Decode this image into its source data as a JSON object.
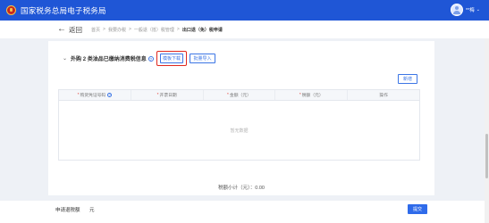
{
  "header": {
    "title": "国家税务总局电子税务局",
    "user_name": "**梅",
    "caret": "⌄"
  },
  "breadcrumb": {
    "back_arrow": "←",
    "back_label": "返回",
    "items": [
      "首页",
      "我要办税",
      "一般退（抵）税管理",
      "出口退（免）税申请"
    ],
    "separator": ">"
  },
  "section": {
    "chevron": "⌄",
    "title": "外购 2 类油品已缴纳消费税信息",
    "help": "?",
    "template_button": "模板下载",
    "import_button": "批量导入",
    "add_button": "新增"
  },
  "table": {
    "columns": [
      {
        "label": "购货凭证号码",
        "required": true,
        "help": true
      },
      {
        "label": "开票日期",
        "required": true,
        "help": false
      },
      {
        "label": "金额（元）",
        "required": true,
        "help": false
      },
      {
        "label": "税额（元）",
        "required": true,
        "help": false
      },
      {
        "label": "操作",
        "required": false,
        "help": false
      }
    ],
    "required_mark": "*",
    "empty_text": "暂无数据"
  },
  "total_text": "税额小计（元）：0.00",
  "footer": {
    "label": "申请退税额",
    "value": "元",
    "submit": "提交"
  },
  "colors": {
    "brand": "#1f56d6",
    "accent": "#3b75e5",
    "highlight": "#e0281e"
  }
}
